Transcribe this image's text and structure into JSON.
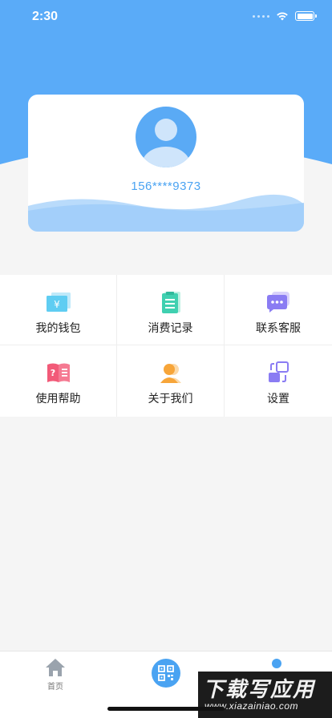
{
  "status_bar": {
    "time": "2:30"
  },
  "profile": {
    "phone": "156****9373"
  },
  "menu": [
    {
      "label": "我的钱包",
      "icon": "wallet-icon"
    },
    {
      "label": "消费记录",
      "icon": "receipt-icon"
    },
    {
      "label": "联系客服",
      "icon": "chat-icon"
    },
    {
      "label": "使用帮助",
      "icon": "help-book-icon"
    },
    {
      "label": "关于我们",
      "icon": "person-icon"
    },
    {
      "label": "设置",
      "icon": "settings-icon"
    }
  ],
  "tabbar": {
    "home_label": "首页"
  },
  "watermark": {
    "main": "下载写应用",
    "sub": "www.xiazainiao.com"
  },
  "colors": {
    "primary": "#4aa3f2",
    "header": "#5aabf8",
    "background": "#f5f5f5"
  }
}
